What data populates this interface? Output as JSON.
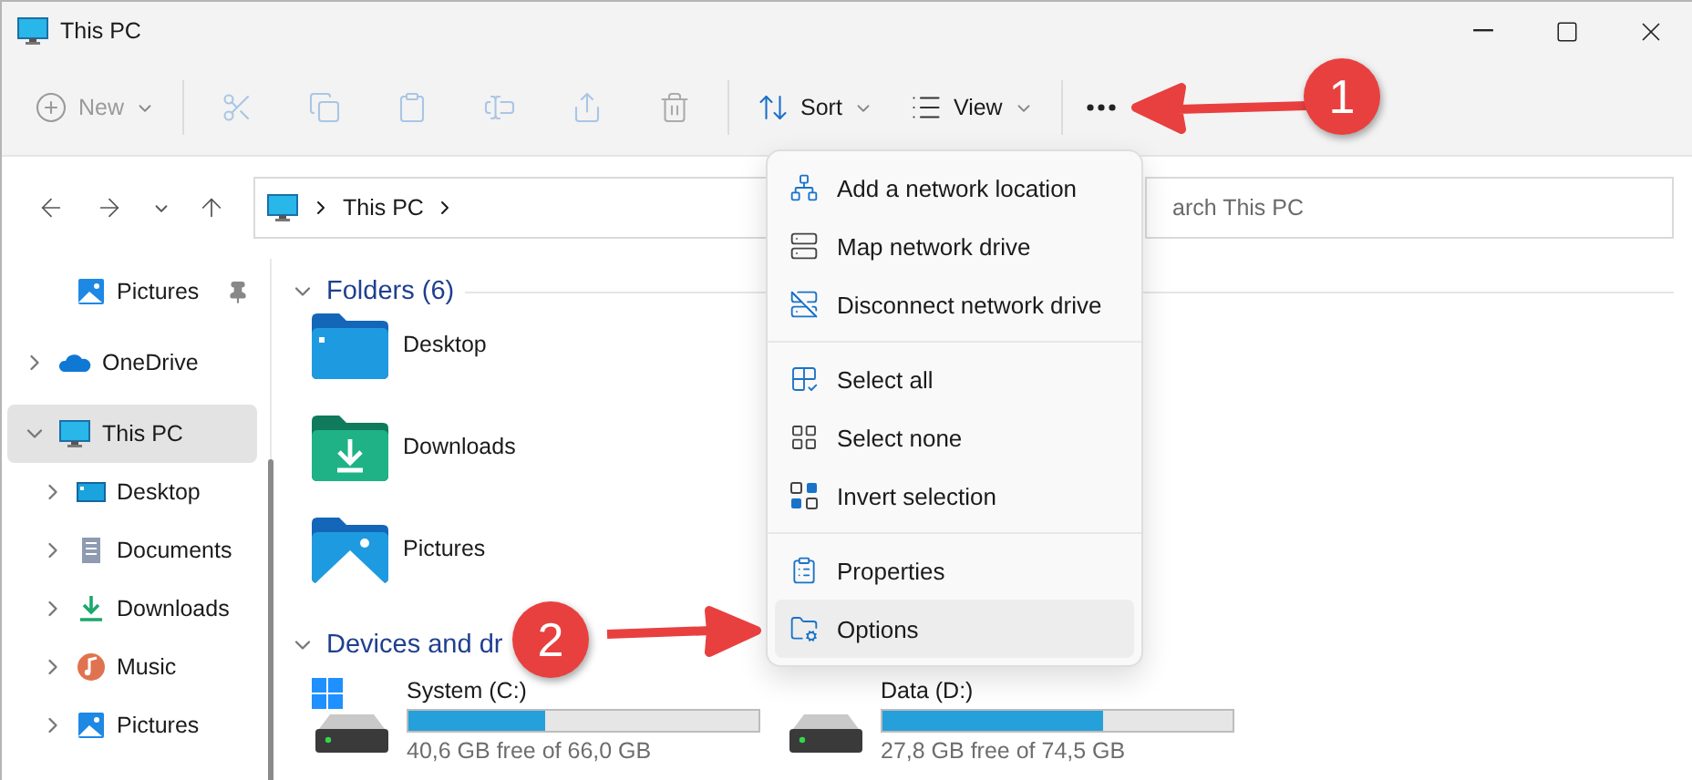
{
  "window": {
    "title": "This PC"
  },
  "toolbar": {
    "items": [
      {
        "kind": "new",
        "label": "New",
        "disabled": true
      },
      {
        "kind": "separator"
      },
      {
        "kind": "cut",
        "disabled": true
      },
      {
        "kind": "copy",
        "disabled": true
      },
      {
        "kind": "paste",
        "disabled": true
      },
      {
        "kind": "rename",
        "disabled": true
      },
      {
        "kind": "share",
        "disabled": true
      },
      {
        "kind": "delete",
        "disabled": true
      },
      {
        "kind": "separator"
      },
      {
        "kind": "sort",
        "label": "Sort",
        "disabled": false
      },
      {
        "kind": "view",
        "label": "View",
        "disabled": false
      },
      {
        "kind": "separator"
      },
      {
        "kind": "more",
        "disabled": false
      }
    ]
  },
  "address": {
    "path": [
      "This PC"
    ]
  },
  "search": {
    "placeholder": "arch This PC"
  },
  "sidebar": {
    "items": [
      {
        "label": "Pictures",
        "pinned": true,
        "selected": false
      },
      {
        "label": "OneDrive",
        "expanded": false,
        "selected": false
      },
      {
        "label": "This PC",
        "expanded": true,
        "selected": true,
        "children": [
          {
            "label": "Desktop",
            "expanded": false,
            "selected": false
          },
          {
            "label": "Documents",
            "expanded": false,
            "selected": false
          },
          {
            "label": "Downloads",
            "expanded": false,
            "selected": false
          },
          {
            "label": "Music",
            "expanded": false,
            "selected": false
          },
          {
            "label": "Pictures",
            "expanded": false,
            "selected": false
          }
        ]
      }
    ]
  },
  "folders": {
    "title": "Folders (6)",
    "expanded": true,
    "items": [
      {
        "name": "Desktop"
      },
      {
        "name": "Downloads"
      },
      {
        "name": "Pictures"
      }
    ]
  },
  "devices": {
    "title": "Devices and dr",
    "expanded": true,
    "drives": [
      {
        "name": "System (C:)",
        "level": 0.39,
        "free": "40,6 GB free of 66,0 GB"
      },
      {
        "name": "Data (D:)",
        "level": 0.63,
        "free": "27,8 GB free of 74,5 GB"
      }
    ]
  },
  "menu": {
    "groups": [
      {
        "items": [
          {
            "label": "Add a network location",
            "selected": false
          },
          {
            "label": "Map network drive",
            "selected": false
          },
          {
            "label": "Disconnect network drive",
            "selected": false
          }
        ]
      },
      {
        "items": [
          {
            "label": "Select all",
            "selected": false
          },
          {
            "label": "Select none",
            "selected": false
          },
          {
            "label": "Invert selection",
            "selected": false
          }
        ]
      },
      {
        "items": [
          {
            "label": "Properties",
            "selected": false
          },
          {
            "label": "Options",
            "selected": true
          }
        ]
      }
    ]
  },
  "annotations": [
    {
      "label": "1"
    },
    {
      "label": "2"
    }
  ]
}
